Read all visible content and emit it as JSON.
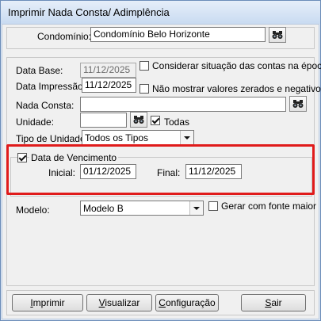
{
  "window": {
    "title": "Imprimir Nada Consta/ Adimplência"
  },
  "condominio": {
    "label": "Condomínio:",
    "value": "Condomínio Belo Horizonte"
  },
  "form": {
    "data_base": {
      "label": "Data Base:",
      "value": "11/12/2025"
    },
    "considerar": {
      "label": "Considerar situação das contas na época",
      "checked": false
    },
    "data_impressao": {
      "label": "Data Impressão:",
      "value": "11/12/2025"
    },
    "nao_mostrar": {
      "label": "Não mostrar valores zerados e negativos",
      "checked": false
    },
    "nada_consta": {
      "label": "Nada Consta:",
      "value": ""
    },
    "unidade": {
      "label": "Unidade:",
      "value": ""
    },
    "todas": {
      "label": "Todas",
      "checked": true
    },
    "tipo_unidade": {
      "label": "Tipo de Unidade:",
      "value": "Todos os Tipos"
    }
  },
  "vencimento": {
    "label": "Data de Vencimento",
    "checked": true,
    "inicial_label": "Inicial:",
    "inicial_value": "01/12/2025",
    "final_label": "Final:",
    "final_value": "11/12/2025"
  },
  "modelo": {
    "label": "Modelo:",
    "value": "Modelo B",
    "fonte_maior": {
      "label": "Gerar com fonte maior",
      "checked": false
    }
  },
  "buttons": {
    "imprimir": {
      "pre": "",
      "key": "I",
      "post": "mprimir"
    },
    "visualizar": {
      "pre": "",
      "key": "V",
      "post": "isualizar"
    },
    "configuracao": {
      "pre": "",
      "key": "C",
      "post": "onfiguração"
    },
    "sair": {
      "pre": "",
      "key": "S",
      "post": "air"
    }
  },
  "colors": {
    "highlight": "#e01b1b",
    "title_bar": "#c9dbf1"
  }
}
